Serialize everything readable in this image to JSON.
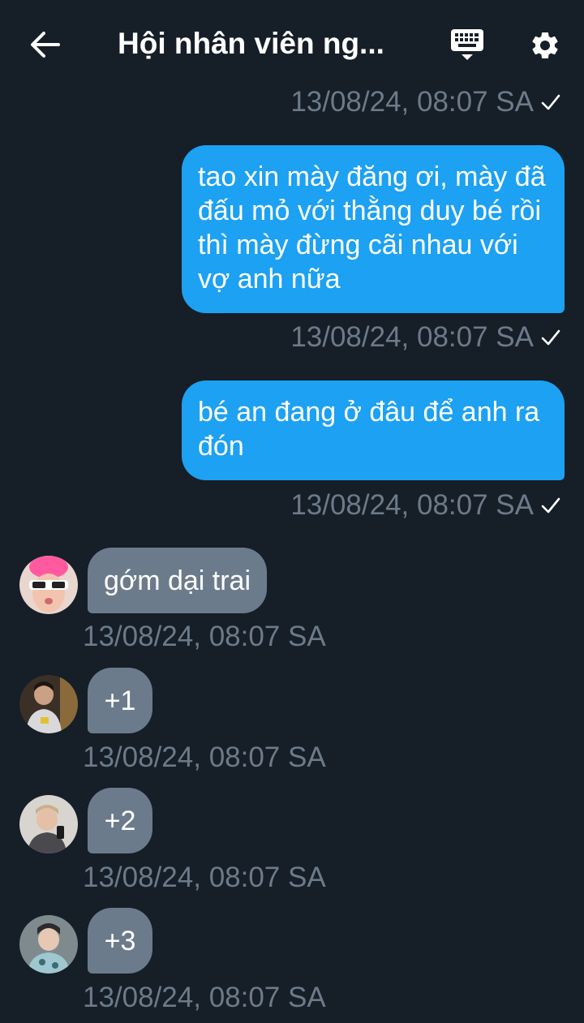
{
  "header": {
    "title": "Hội nhân viên ng...",
    "back_icon": "arrow-left-icon",
    "keyboard_icon": "keyboard-icon",
    "settings_icon": "gear-icon"
  },
  "colors": {
    "background": "#161e27",
    "outgoing_bubble": "#1da1f2",
    "incoming_bubble": "#6c7b8b",
    "timestamp": "#6c7a89"
  },
  "messages": [
    {
      "direction": "out",
      "timestamp": "13/08/24, 08:07 SA",
      "text": ""
    },
    {
      "direction": "out",
      "text": "tao xin mày đăng ơi, mày đã đấu mỏ với thằng duy bé rồi thì mày đừng cãi nhau với vợ anh nữa",
      "timestamp": "13/08/24, 08:07 SA"
    },
    {
      "direction": "out",
      "text": "bé an đang ở đâu để anh ra đón",
      "timestamp": "13/08/24, 08:07 SA"
    },
    {
      "direction": "in",
      "text": "gớm dại trai",
      "timestamp": "13/08/24, 08:07 SA"
    },
    {
      "direction": "in",
      "text": "+1",
      "timestamp": "13/08/24, 08:07 SA"
    },
    {
      "direction": "in",
      "text": "+2",
      "timestamp": "13/08/24, 08:07 SA"
    },
    {
      "direction": "in",
      "text": "+3",
      "timestamp": "13/08/24, 08:07 SA"
    }
  ]
}
